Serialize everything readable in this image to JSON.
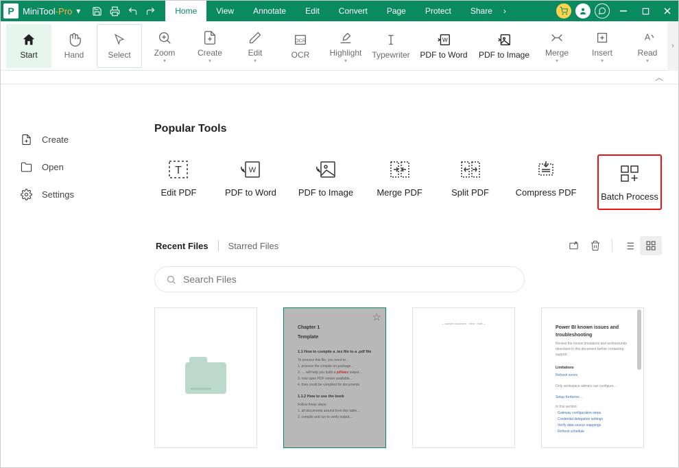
{
  "app": {
    "name": "MiniTool",
    "suffix": "-Pro"
  },
  "menu": [
    "Home",
    "View",
    "Annotate",
    "Edit",
    "Convert",
    "Page",
    "Protect",
    "Share"
  ],
  "menu_active": 0,
  "ribbon": [
    {
      "label": "Start",
      "dark": true,
      "active": true,
      "drop": false
    },
    {
      "label": "Hand",
      "drop": false
    },
    {
      "label": "Select",
      "drop": false,
      "border": true
    },
    {
      "label": "Zoom",
      "drop": true
    },
    {
      "label": "Create",
      "drop": true
    },
    {
      "label": "Edit",
      "drop": true
    },
    {
      "label": "OCR",
      "drop": false
    },
    {
      "label": "Highlight",
      "drop": true
    },
    {
      "label": "Typewriter",
      "drop": false
    },
    {
      "label": "PDF to Word",
      "dark": true,
      "drop": false,
      "wide": true
    },
    {
      "label": "PDF to Image",
      "dark": true,
      "drop": false,
      "wide": true
    },
    {
      "label": "Merge",
      "drop": true
    },
    {
      "label": "Insert",
      "drop": true
    },
    {
      "label": "Read",
      "drop": true
    }
  ],
  "sidebar": [
    {
      "label": "Create"
    },
    {
      "label": "Open"
    },
    {
      "label": "Settings"
    }
  ],
  "popular_title": "Popular Tools",
  "popular_tools": [
    {
      "label": "Edit PDF"
    },
    {
      "label": "PDF to Word"
    },
    {
      "label": "PDF to Image"
    },
    {
      "label": "Merge PDF"
    },
    {
      "label": "Split PDF"
    },
    {
      "label": "Compress PDF"
    },
    {
      "label": "Batch Process",
      "highlight": true
    }
  ],
  "files": {
    "tab_recent": "Recent Files",
    "tab_starred": "Starred Files"
  },
  "search": {
    "placeholder": "Search Files"
  },
  "thumb_chapter": {
    "h1": "Chapter 1",
    "h2": "Template",
    "sub1": "1.1  How to compile a .tex file to a .pdf file",
    "sub2": "1.1.2  How to use the book"
  },
  "thumb_power": {
    "title": "Power BI known issues and troubleshooting"
  }
}
